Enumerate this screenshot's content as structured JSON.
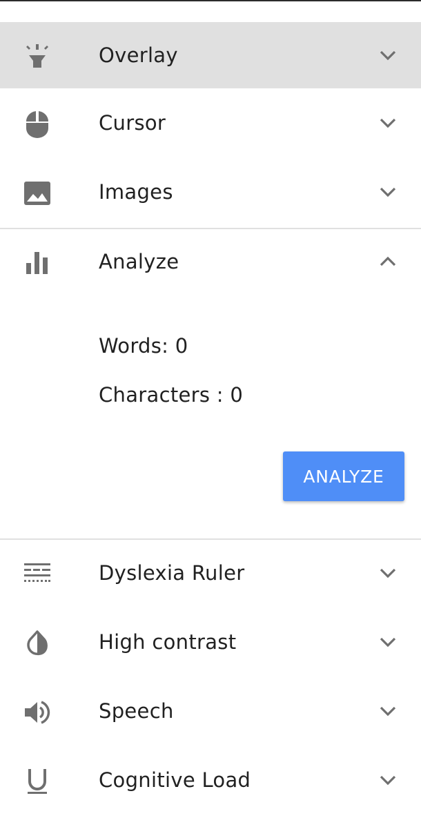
{
  "panel": {
    "items": [
      {
        "label": "Overlay",
        "icon": "flashlight-icon",
        "expanded": false,
        "active": true
      },
      {
        "label": "Cursor",
        "icon": "mouse-icon",
        "expanded": false,
        "active": false
      },
      {
        "label": "Images",
        "icon": "image-icon",
        "expanded": false,
        "active": false
      },
      {
        "label": "Analyze",
        "icon": "bar-chart-icon",
        "expanded": true,
        "active": false
      },
      {
        "label": "Dyslexia Ruler",
        "icon": "ruler-lines-icon",
        "expanded": false,
        "active": false
      },
      {
        "label": "High contrast",
        "icon": "contrast-drop-icon",
        "expanded": false,
        "active": false
      },
      {
        "label": "Speech",
        "icon": "speaker-icon",
        "expanded": false,
        "active": false
      },
      {
        "label": "Cognitive Load",
        "icon": "underline-icon",
        "expanded": false,
        "active": false
      }
    ],
    "analyze": {
      "words": "Words: 0",
      "characters": "Characters : 0",
      "button_label": "ANALYZE"
    }
  },
  "colors": {
    "active_row_bg": "#e0e0e0",
    "icon_gray": "#6f6f6f",
    "button_blue": "#4f8ef7",
    "divider": "#e0e0e0"
  }
}
